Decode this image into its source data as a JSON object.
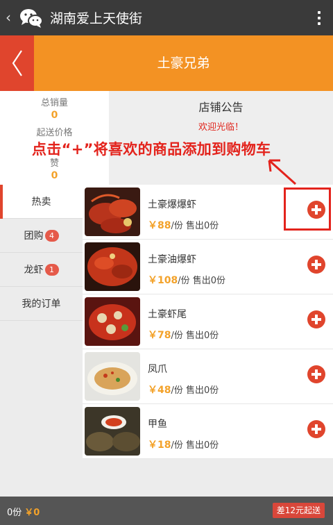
{
  "appbar": {
    "title": "湖南爱上天使街"
  },
  "header": {
    "title": "土豪兄弟"
  },
  "stats": [
    {
      "label": "总销量",
      "value": "0"
    },
    {
      "label": "起送价格"
    },
    {
      "label": "赞",
      "value": "0"
    }
  ],
  "notice": {
    "title": "店铺公告",
    "text": "欢迎光临！"
  },
  "overlay": {
    "instruction": "点击“+”将喜欢的商品添加到购物车"
  },
  "categories": [
    {
      "label": "热卖"
    },
    {
      "label": "团购",
      "badge": "4"
    },
    {
      "label": "龙虾",
      "badge": "1"
    },
    {
      "label": "我的订单"
    }
  ],
  "products": [
    {
      "name": "土豪爆爆虾",
      "price": "￥88",
      "unit": "/份",
      "sold": "售出0份"
    },
    {
      "name": "土豪油爆虾",
      "price": "￥108",
      "unit": "/份",
      "sold": "售出0份"
    },
    {
      "name": "土豪虾尾",
      "price": "￥78",
      "unit": "/份",
      "sold": "售出0份"
    },
    {
      "name": "凤爪",
      "price": "￥48",
      "unit": "/份",
      "sold": "售出0份"
    },
    {
      "name": "甲鱼",
      "price": "￥18",
      "unit": "/份",
      "sold": "售出0份"
    }
  ],
  "footer": {
    "count": "0份",
    "total": "￥0",
    "min_order": "差12元起送"
  },
  "colors": {
    "header": "#f39223",
    "accent_red": "#e0452d",
    "price": "#f3a22a",
    "appbar": "#3a3a3a"
  }
}
